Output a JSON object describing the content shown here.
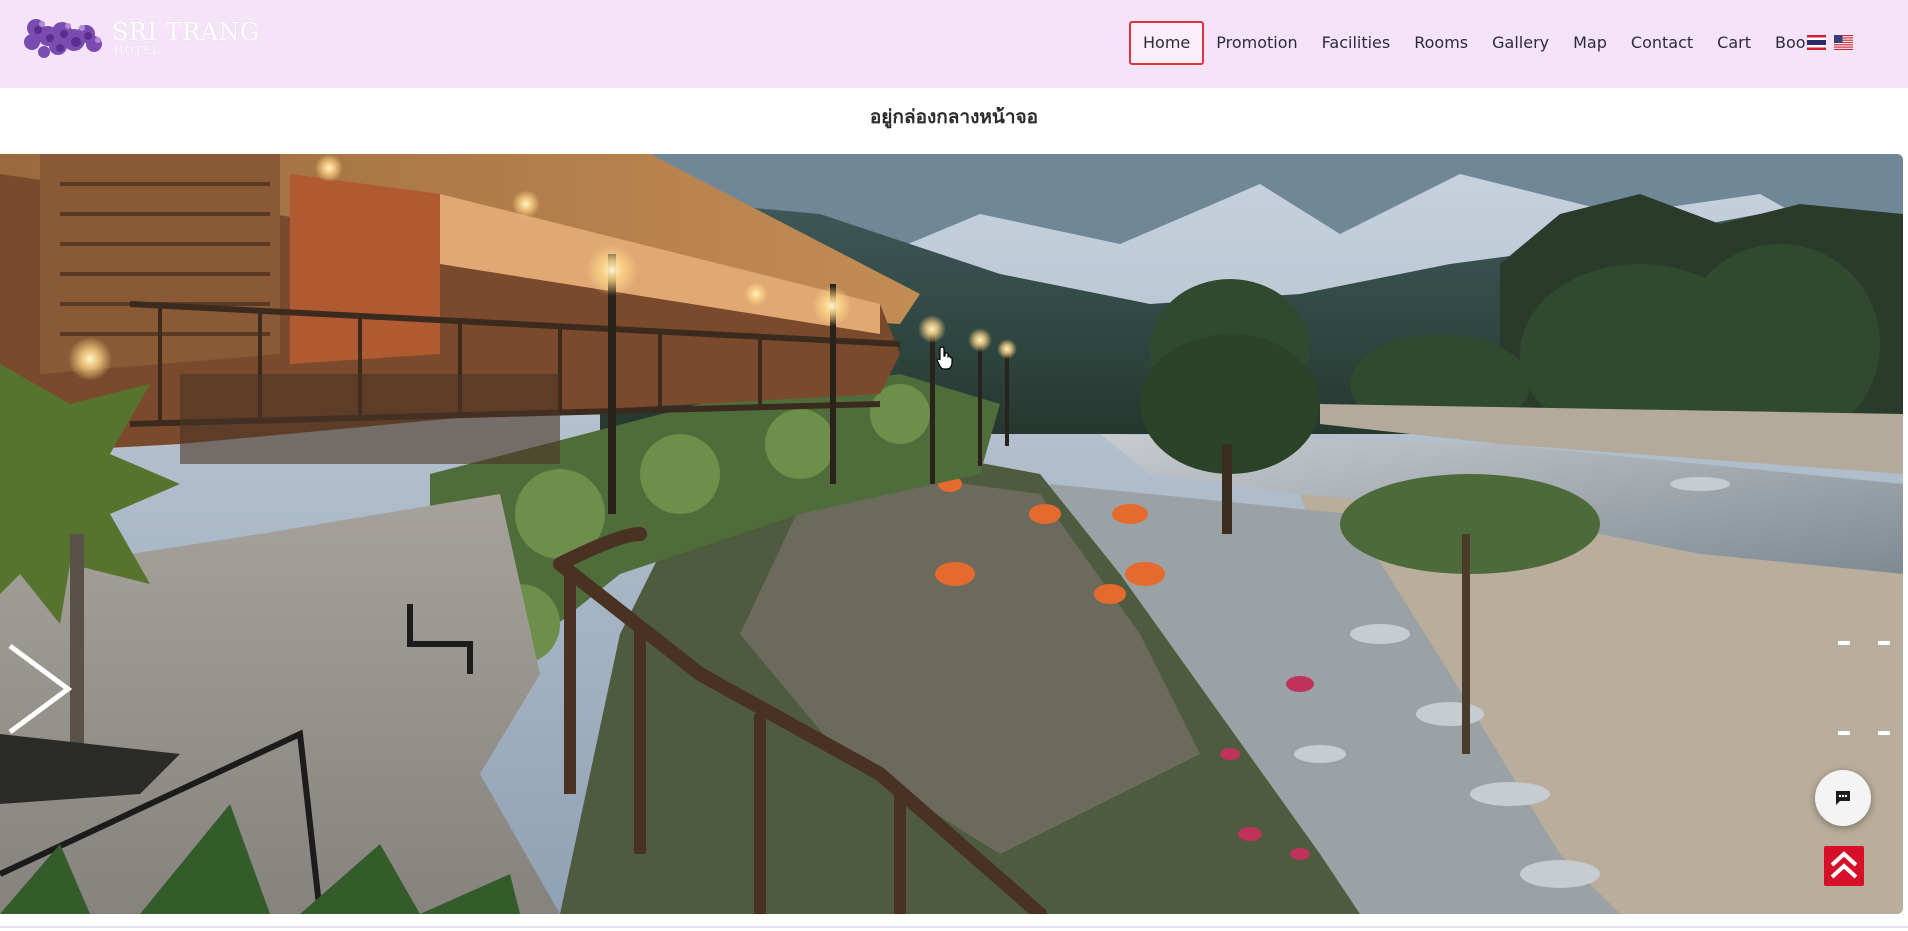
{
  "brand": {
    "name": "SRI TRANG",
    "subtitle": "HOTEL"
  },
  "nav": {
    "items": [
      {
        "label": "Home",
        "active": true
      },
      {
        "label": "Promotion"
      },
      {
        "label": "Facilities"
      },
      {
        "label": "Rooms"
      },
      {
        "label": "Gallery"
      },
      {
        "label": "Map"
      },
      {
        "label": "Contact"
      },
      {
        "label": "Cart"
      },
      {
        "label": "Book"
      }
    ],
    "languages": [
      "th-flag-icon",
      "us-flag-icon"
    ]
  },
  "caption": "อยู่กล่องกลางหน้าจอ",
  "slider": {
    "scene": "resort-riverside-evening",
    "next_icon": "chevron-right-icon",
    "indicator_count": 4
  },
  "floating": {
    "chat_icon": "chat-bubble-icon",
    "top_icon": "double-chevron-up-icon"
  },
  "colors": {
    "header_bg": "#f5e4f8",
    "active_border": "#e0333f",
    "back_to_top": "#d7102a",
    "text": "#2b2b3a"
  }
}
